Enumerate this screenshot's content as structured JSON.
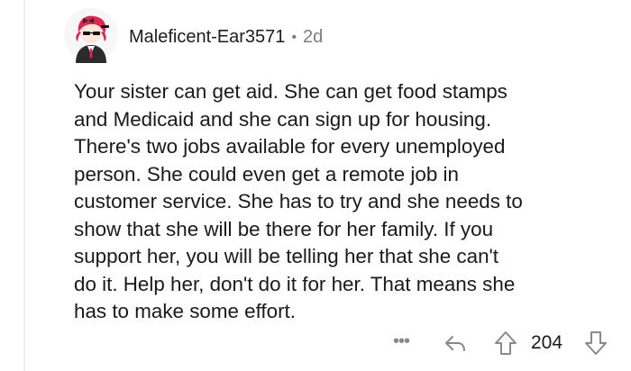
{
  "comment": {
    "username": "Maleficent-Ear3571",
    "separator": "•",
    "timestamp": "2d",
    "body": [
      "Your sister can get aid. She can get food stamps",
      "and Medicaid and she can sign up for housing.",
      "There's two jobs available for every unemployed",
      "person. She could even get a remote job in",
      "customer service. She has to try and she needs to",
      "show that she will be there for her family.  If you",
      "support her, you will be telling her that she can't",
      "do it.  Help her, don't do it for her.  That means she",
      "has to make some effort."
    ]
  },
  "actions": {
    "more_label": "•••",
    "vote_count": "204"
  },
  "icons": {
    "avatar": "user-avatar",
    "more": "more-options-icon",
    "reply": "reply-icon",
    "upvote": "upvote-icon",
    "downvote": "downvote-icon"
  },
  "colors": {
    "text": "#1a1a1b",
    "meta": "#7c7c7c",
    "icon": "#878a8c",
    "avatar_hair": "#e0244a",
    "thread_line": "#edeff1"
  }
}
